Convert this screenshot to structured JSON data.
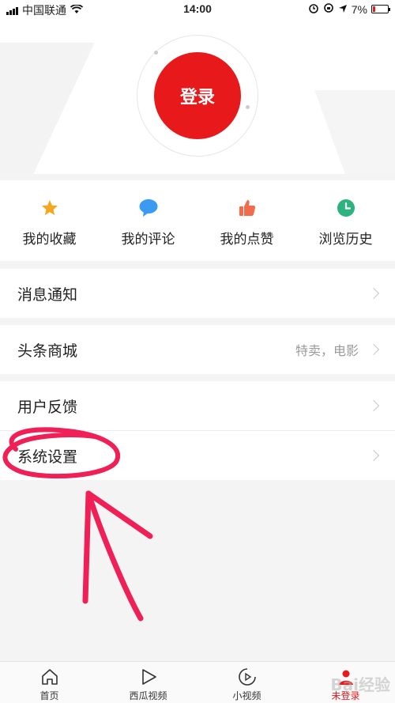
{
  "status": {
    "carrier": "中国联通",
    "time": "14:00",
    "battery": "7%",
    "icons": [
      "signal-icon",
      "wifi-icon",
      "alarm-icon",
      "orientation-lock-icon",
      "location-icon",
      "battery-icon"
    ]
  },
  "header": {
    "login_label": "登录"
  },
  "quick": [
    {
      "label": "我的收藏",
      "icon": "star-icon",
      "color": "#f5a623"
    },
    {
      "label": "我的评论",
      "icon": "comment-icon",
      "color": "#3a9bf0"
    },
    {
      "label": "我的点赞",
      "icon": "thumbs-up-icon",
      "color": "#f26b4b"
    },
    {
      "label": "浏览历史",
      "icon": "clock-icon",
      "color": "#2db37e"
    }
  ],
  "menu": {
    "notifications": {
      "label": "消息通知"
    },
    "mall": {
      "label": "头条商城",
      "sub": "特卖，电影"
    },
    "feedback": {
      "label": "用户反馈"
    },
    "settings": {
      "label": "系统设置"
    }
  },
  "annotation_color": "#f01f55",
  "tabs": [
    {
      "label": "首页",
      "icon": "home-icon"
    },
    {
      "label": "西瓜视频",
      "icon": "play-icon"
    },
    {
      "label": "小视频",
      "icon": "small-video-icon"
    },
    {
      "label": "未登录",
      "icon": "user-icon",
      "active": true
    }
  ],
  "watermark": "Bai经验"
}
